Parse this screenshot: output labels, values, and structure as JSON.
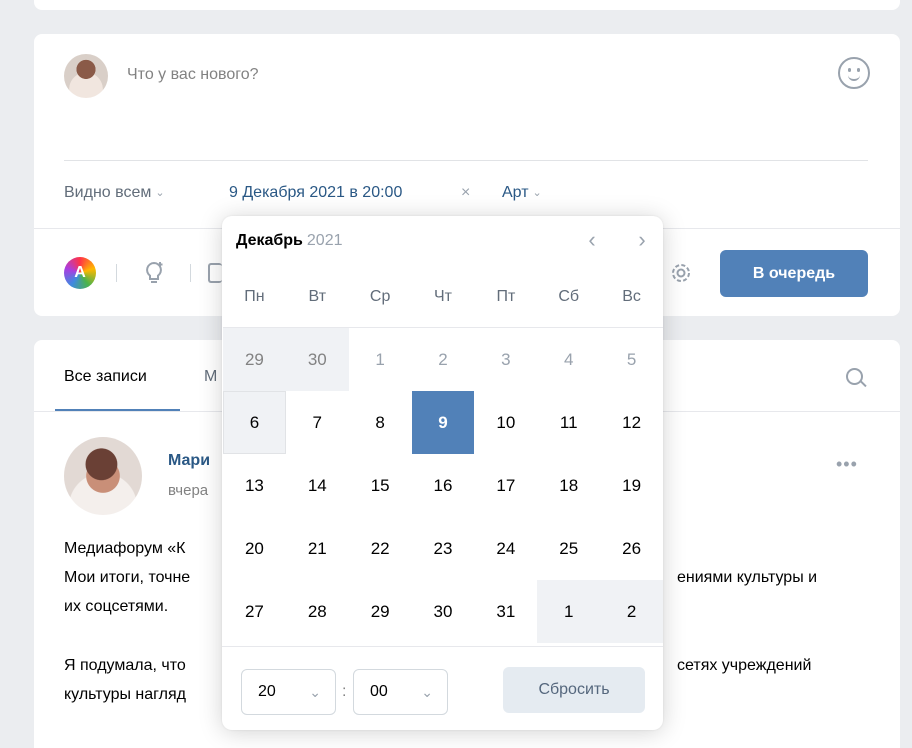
{
  "composer": {
    "placeholder": "Что у вас нового?",
    "visibility_label": "Видно всем",
    "scheduled_date": "9 Декабря 2021 в 20:00",
    "clear_symbol": "×",
    "author_label": "Арт",
    "tool_a_label": "A",
    "queue_button": "В очередь"
  },
  "feed": {
    "tabs": [
      {
        "label": "Все записи"
      },
      {
        "label": "М"
      }
    ],
    "post": {
      "author": "Мари",
      "time": "вчера",
      "more": "•••",
      "lines": [
        "Медиафорум «К",
        "Мои итоги, точне",
        "их соцсетями.",
        "Я подумала, что",
        "культуры нагляд"
      ],
      "right_lines": [
        "ениями культуры и",
        "сетях учреждений"
      ]
    }
  },
  "calendar": {
    "month": "Декабрь",
    "year": "2021",
    "prev": "‹",
    "next": "›",
    "weekdays": [
      "Пн",
      "Вт",
      "Ср",
      "Чт",
      "Пт",
      "Сб",
      "Вс"
    ],
    "weeks": [
      [
        "29",
        "30",
        "1",
        "2",
        "3",
        "4",
        "5"
      ],
      [
        "6",
        "7",
        "8",
        "9",
        "10",
        "11",
        "12"
      ],
      [
        "13",
        "14",
        "15",
        "16",
        "17",
        "18",
        "19"
      ],
      [
        "20",
        "21",
        "22",
        "23",
        "24",
        "25",
        "26"
      ],
      [
        "27",
        "28",
        "29",
        "30",
        "31",
        "1",
        "2"
      ]
    ],
    "selected_day": "9",
    "today_day": "6",
    "hour": "20",
    "minute": "00",
    "separator": ":",
    "reset_button": "Сбросить"
  }
}
